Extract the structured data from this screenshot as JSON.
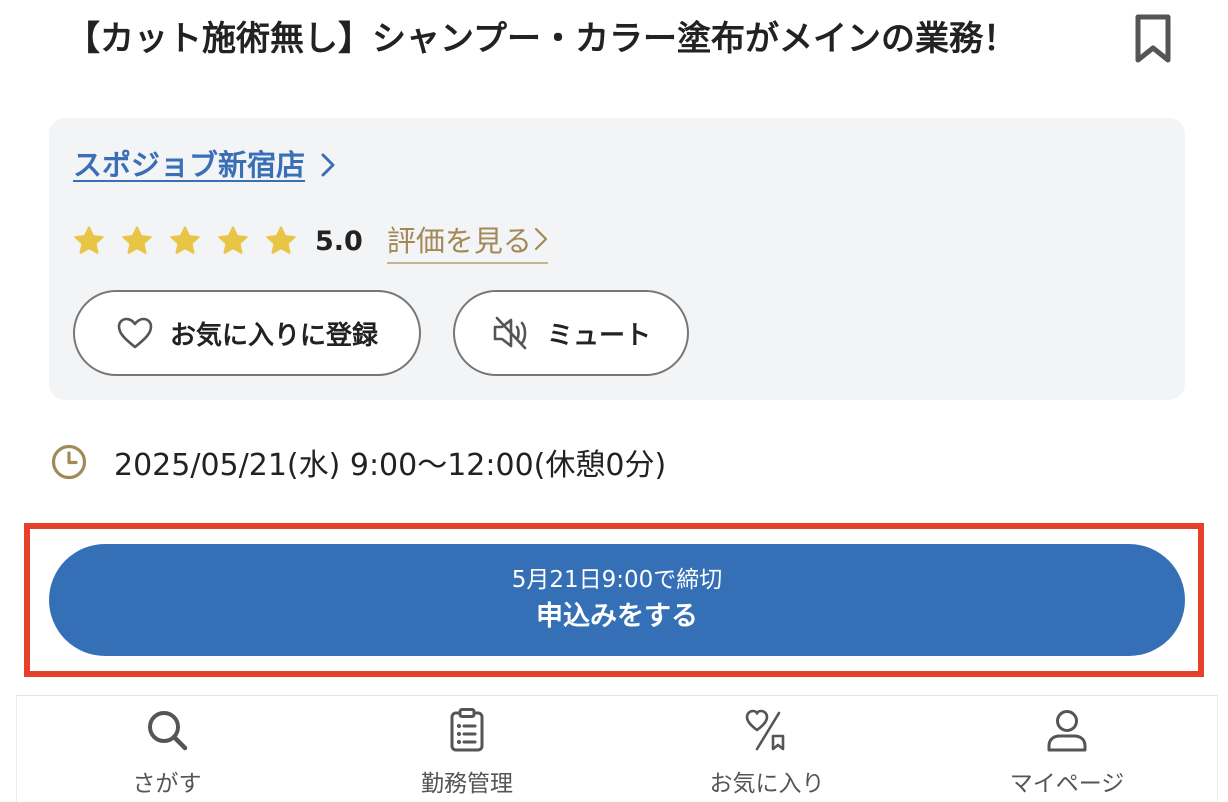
{
  "job": {
    "title": "【カット施術無し】シャンプー・カラー塗布がメインの業務！"
  },
  "store": {
    "name": "スポジョブ新宿店",
    "rating": {
      "stars": 5,
      "max_stars": 5,
      "score": "5.0",
      "review_link_label": "評価を見る"
    },
    "favorite_button_label": "お気に入りに登録",
    "mute_button_label": "ミュート"
  },
  "schedule": {
    "text": "2025/05/21(水) 9:00〜12:00(休憩0分)"
  },
  "apply": {
    "deadline": "5月21日9:00で締切",
    "label": "申込みをする"
  },
  "tabbar": {
    "items": [
      {
        "label": "さがす",
        "icon": "search-icon"
      },
      {
        "label": "勤務管理",
        "icon": "clipboard-list-icon"
      },
      {
        "label": "お気に入り",
        "icon": "heart-percent-icon"
      },
      {
        "label": "マイページ",
        "icon": "person-icon"
      }
    ]
  },
  "colors": {
    "primary": "#3570b7",
    "link": "#3a6fb6",
    "gold": "#a28a57",
    "star": "#e8c547",
    "highlight": "#e5402a",
    "card_bg": "#f3f4f6"
  }
}
